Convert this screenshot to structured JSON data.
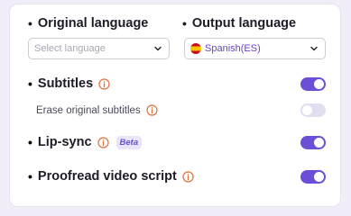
{
  "languages": {
    "original": {
      "label": "Original language",
      "placeholder": "Select language"
    },
    "output": {
      "label": "Output language",
      "value": "Spanish(ES)"
    }
  },
  "options": {
    "subtitles": {
      "label": "Subtitles",
      "enabled": true
    },
    "erase_subtitles": {
      "label": "Erase original subtitles",
      "enabled": false
    },
    "lip_sync": {
      "label": "Lip-sync",
      "badge": "Beta",
      "enabled": true
    },
    "proofread": {
      "label": "Proofread video script",
      "enabled": true
    }
  },
  "colors": {
    "accent": "#6b4fd6",
    "info_icon": "#e0703a",
    "toggle_off": "#e2def0"
  },
  "icons": {
    "info": "info-icon",
    "chevron": "chevron-down-icon",
    "flag": "spain-flag-icon"
  }
}
